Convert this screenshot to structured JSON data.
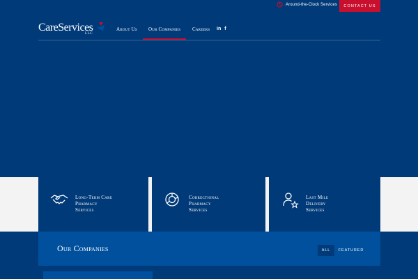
{
  "utility": {
    "around_clock": "Around-the-Clock Services",
    "contact": "CONTACT US"
  },
  "logo": {
    "name": "CareServices",
    "suffix": "LLC"
  },
  "nav": {
    "items": [
      {
        "label": "About Us"
      },
      {
        "label": "Our Companies",
        "active": true
      },
      {
        "label": "Careers"
      }
    ],
    "social": {
      "linkedin": "in",
      "facebook": "f"
    }
  },
  "cards": [
    {
      "icon": "handshake-icon",
      "label": "Long-Term Care\nPharmacy\nServices"
    },
    {
      "icon": "pie-chart-icon",
      "label": "Correctional\nPharmacy\nServices"
    },
    {
      "icon": "user-star-icon",
      "label": "Last Mile\nDelivery\nServices"
    }
  ],
  "companies": {
    "title": "Our Companies",
    "filters": [
      "ALL",
      "FEATURED"
    ],
    "active_filter": "ALL"
  },
  "colors": {
    "primary_blue": "#003a78",
    "section_blue": "#00509e",
    "accent_red": "#c8102e",
    "band_gray": "#f3f3f3"
  }
}
